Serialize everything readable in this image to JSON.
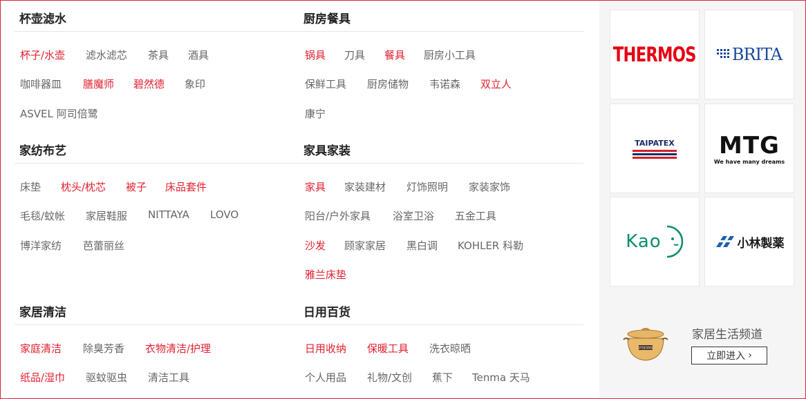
{
  "sections": {
    "cups": {
      "title": "杯壶滤水",
      "rows": [
        [
          {
            "label": "杯子/水壶",
            "hot": true
          },
          {
            "label": "滤水滤芯",
            "hot": false
          },
          {
            "label": "茶具",
            "hot": false
          },
          {
            "label": "酒具",
            "hot": false
          }
        ],
        [
          {
            "label": "咖啡器皿",
            "hot": false
          },
          {
            "label": "膳魔师",
            "hot": true
          },
          {
            "label": "碧然德",
            "hot": true
          },
          {
            "label": "象印",
            "hot": false
          }
        ],
        [
          {
            "label": "ASVEL 阿司倍鹭",
            "hot": false
          }
        ]
      ]
    },
    "kitchen": {
      "title": "厨房餐具",
      "rows": [
        [
          {
            "label": "锅具",
            "hot": true
          },
          {
            "label": "刀具",
            "hot": false
          },
          {
            "label": "餐具",
            "hot": true
          },
          {
            "label": "厨房小工具",
            "hot": false
          }
        ],
        [
          {
            "label": "保鲜工具",
            "hot": false
          },
          {
            "label": "厨房储物",
            "hot": false
          },
          {
            "label": "韦诺森",
            "hot": false
          },
          {
            "label": "双立人",
            "hot": true
          }
        ],
        [
          {
            "label": "康宁",
            "hot": false
          }
        ]
      ]
    },
    "textile": {
      "title": "家纺布艺",
      "rows": [
        [
          {
            "label": "床垫",
            "hot": false
          },
          {
            "label": "枕头/枕芯",
            "hot": true
          },
          {
            "label": "被子",
            "hot": true
          },
          {
            "label": "床品套件",
            "hot": true
          }
        ],
        [
          {
            "label": "毛毯/蚊帐",
            "hot": false
          },
          {
            "label": "家居鞋服",
            "hot": false
          },
          {
            "label": "NITTAYA",
            "hot": false
          },
          {
            "label": "LOVO",
            "hot": false
          }
        ],
        [
          {
            "label": "博洋家纺",
            "hot": false
          },
          {
            "label": "芭蕾丽丝",
            "hot": false
          }
        ]
      ]
    },
    "furniture": {
      "title": "家具家装",
      "rows": [
        [
          {
            "label": "家具",
            "hot": true
          },
          {
            "label": "家装建材",
            "hot": false
          },
          {
            "label": "灯饰照明",
            "hot": false
          },
          {
            "label": "家装家饰",
            "hot": false
          }
        ],
        [
          {
            "label": "阳台/户外家具",
            "hot": false
          },
          {
            "label": "浴室卫浴",
            "hot": false
          },
          {
            "label": "五金工具",
            "hot": false
          }
        ],
        [
          {
            "label": "沙发",
            "hot": true
          },
          {
            "label": "顾家家居",
            "hot": false
          },
          {
            "label": "黑白调",
            "hot": false
          },
          {
            "label": "KOHLER 科勒",
            "hot": false
          }
        ],
        [
          {
            "label": "雅兰床垫",
            "hot": true
          }
        ]
      ]
    },
    "cleaning": {
      "title": "家居清洁",
      "rows": [
        [
          {
            "label": "家庭清洁",
            "hot": true
          },
          {
            "label": "除臭芳香",
            "hot": false
          },
          {
            "label": "衣物清洁/护理",
            "hot": true
          }
        ],
        [
          {
            "label": "纸品/湿巾",
            "hot": true
          },
          {
            "label": "驱蚊驱虫",
            "hot": false
          },
          {
            "label": "清洁工具",
            "hot": false
          }
        ]
      ]
    },
    "daily": {
      "title": "日用百货",
      "rows": [
        [
          {
            "label": "日用收纳",
            "hot": true
          },
          {
            "label": "保暖工具",
            "hot": true
          },
          {
            "label": "洗衣晾晒",
            "hot": false
          }
        ],
        [
          {
            "label": "个人用品",
            "hot": false
          },
          {
            "label": "礼物/文创",
            "hot": false
          },
          {
            "label": "蕉下",
            "hot": false
          },
          {
            "label": "Tenma 天马",
            "hot": false
          }
        ]
      ]
    }
  },
  "brands": {
    "thermos": "THERMOS",
    "brita": "BRITA",
    "taipatex": "TAIPATEX",
    "mtg": "MTG",
    "mtg_tagline": "We have many dreams",
    "kao": "Kao",
    "kobayashi": "小林製薬"
  },
  "promo": {
    "title": "家居生活频道",
    "button": "立即进入",
    "pot_label": "VISIONS"
  },
  "colors": {
    "accent": "#e3202f",
    "border": "#d9233b",
    "text": "#666666",
    "thermos": "#e60012",
    "brita": "#1a4a9b",
    "kao": "#0a8f6a",
    "kobayashi": "#1f5fb0"
  }
}
